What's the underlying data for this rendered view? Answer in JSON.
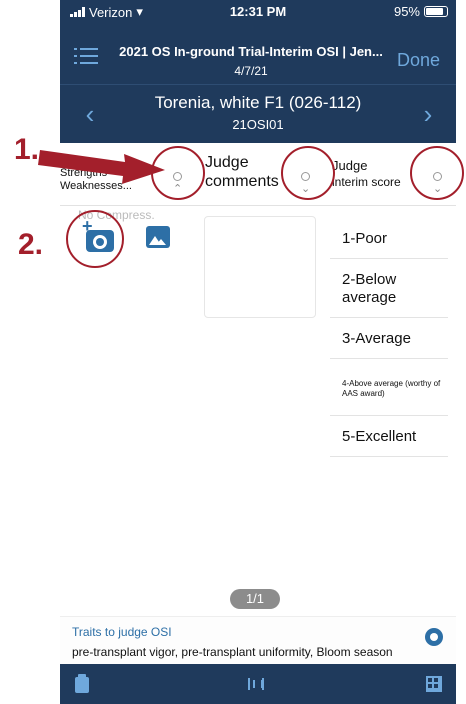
{
  "status_bar": {
    "carrier": "Verizon",
    "time": "12:31 PM",
    "battery": "95%"
  },
  "navbar": {
    "title": "2021 OS In-ground Trial-Interim OSI | Jen...",
    "date": "4/7/21",
    "done_label": "Done"
  },
  "subnav": {
    "title": "Torenia, white F1 (026-112)",
    "code": "21OSI01"
  },
  "columns": [
    {
      "label_line1": "Strengths",
      "label_line2": "Weaknesses..."
    },
    {
      "label_line1": "Judge",
      "label_line2": "comments"
    },
    {
      "label_line1": "Judge",
      "label_line2": "interim score"
    }
  ],
  "photo": {
    "compress_hint": "No Compress."
  },
  "scores": [
    "1-Poor",
    "2-Below average",
    "3-Average",
    "4-Above average (worthy of AAS award)",
    "5-Excellent"
  ],
  "pager": "1/1",
  "traits": {
    "title": "Traits to judge OSI",
    "list": "pre-transplant vigor, pre-transplant uniformity, Bloom season"
  },
  "annotations": {
    "label1": "1.",
    "label2": "2."
  },
  "colors": {
    "header_bg": "#1f3a5c",
    "accent": "#6fa8dc",
    "icon_blue": "#2d6fa6",
    "annotation_red": "#a31f2b"
  }
}
